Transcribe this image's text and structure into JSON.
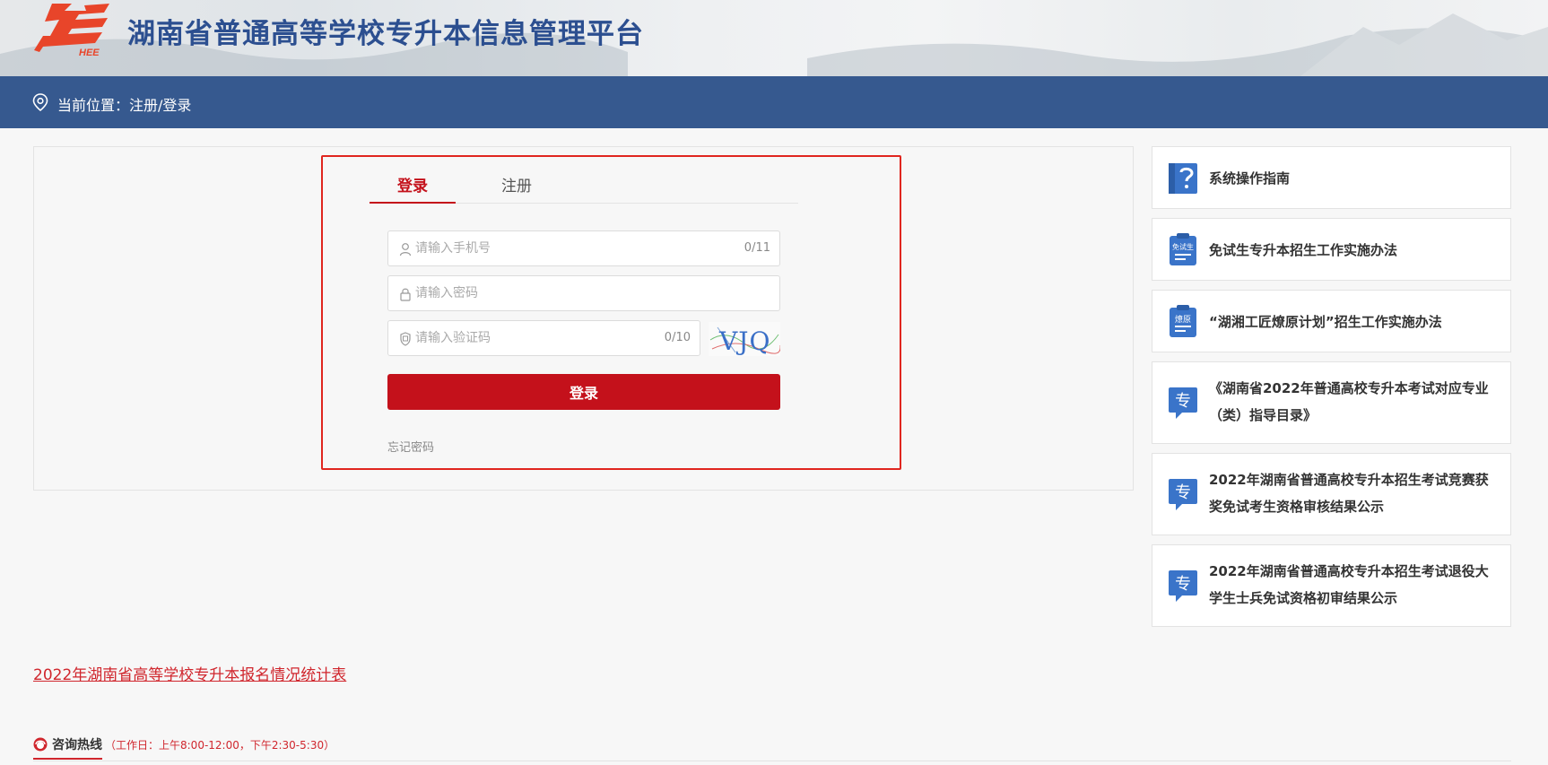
{
  "header": {
    "logo_text": "HEE",
    "title": "湖南省普通高等学校专升本信息管理平台"
  },
  "location": {
    "text": "当前位置：注册/登录"
  },
  "login": {
    "tabs": [
      {
        "label": "登录",
        "active": true
      },
      {
        "label": "注册",
        "active": false
      }
    ],
    "phone": {
      "placeholder": "请输入手机号",
      "value": "",
      "counter": "0/11"
    },
    "password": {
      "placeholder": "请输入密码",
      "value": ""
    },
    "captcha": {
      "placeholder": "请输入验证码",
      "value": "",
      "counter": "0/10",
      "image_text": "VJQ"
    },
    "submit_label": "登录",
    "forgot_label": "忘记密码"
  },
  "sidebar": {
    "items": [
      {
        "icon": "help-book-icon",
        "label": "系统操作指南"
      },
      {
        "icon": "clipboard-icon",
        "icon_text": "免试生",
        "label": "免试生专升本招生工作实施办法"
      },
      {
        "icon": "clipboard-icon",
        "icon_text": "燎原",
        "label": "“湖湘工匠燎原计划”招生工作实施办法"
      },
      {
        "icon": "speech-bubble-icon",
        "icon_text": "专",
        "label": "《湖南省2022年普通高校专升本考试对应专业（类）指导目录》"
      },
      {
        "icon": "speech-bubble-icon",
        "icon_text": "专",
        "label": "2022年湖南省普通高校专升本招生考试竞赛获奖免试考生资格审核结果公示"
      },
      {
        "icon": "speech-bubble-icon",
        "icon_text": "专",
        "label": "2022年湖南省普通高校专升本招生考试退役大学生士兵免试资格初审结果公示"
      }
    ]
  },
  "stats_link": "2022年湖南省高等学校专升本报名情况统计表",
  "hotline": {
    "label": "咨询热线",
    "hours": "（工作日：上午8:00-12:00，下午2:30-5:30）"
  },
  "colors": {
    "brand_blue": "#36598f",
    "title_blue": "#2c4f90",
    "accent_red": "#c4111b",
    "link_red": "#d0262d",
    "icon_blue": "#3a74c9"
  }
}
